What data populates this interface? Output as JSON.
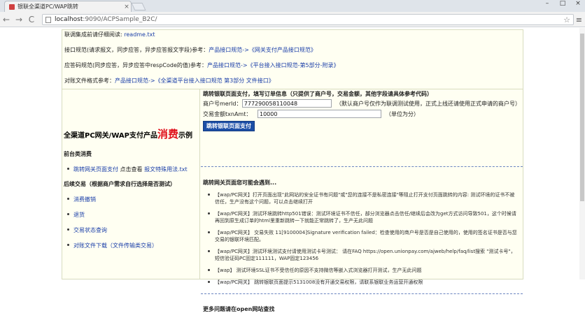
{
  "browser": {
    "tab_title": "银联全渠道PC/WAP跳转",
    "close": "×",
    "win_min": "–",
    "win_max": "□",
    "win_close": "×",
    "back": "←",
    "forward": "→",
    "reload": "C",
    "url_host": "localhost",
    "url_path": ":9090/ACPSample_B2C/",
    "star": "☆",
    "menu": "≡"
  },
  "top": {
    "line1_prefix": "联调集成前请仔细阅读: ",
    "line1_link": "readme.txt",
    "line2_prefix": "接口规范(请求报文，同步应答，异步应答报文字段)参考：",
    "line2_link1": "产品接口规范->",
    "line2_link2": "《网关支付产品接口规范》",
    "line3_prefix": "应答码规范(同步应答，异步应答中respCode的值)参考：",
    "line3_link1": "产品接口规范->",
    "line3_link2": "《平台接入接口规范-第5部分-附录》",
    "line4_prefix": "对账文件格式参考：",
    "line4_link1": "产品接口规范->",
    "line4_link2": "《全渠道平台接入接口规范 第3部分 文件接口》"
  },
  "left": {
    "title_a": "全渠道PC网关/WAP支付产品",
    "title_hot": "消费",
    "title_b": "示例",
    "sec1": "前台类消费",
    "item1_link": "跳转网关页面支付",
    "item1_mid": "  点击查看 ",
    "item1_link2": "报文特殊用法.txt",
    "sec2": "后续交易（根据商户需求自行选择是否测试）",
    "items": [
      "消费撤销",
      "退货",
      "交易状态查询",
      "对账文件下载（文件传输类交易）"
    ]
  },
  "form": {
    "heading": "跳转银联页面支付，填写订单信息（只提供了商户号，交易金额，其他字段请具体参考代码）",
    "mer_label": "商户号merId：",
    "mer_value": "777290058110048",
    "mer_note": "（默认商户号仅作为联调测试使用，正式上线还请使用正式申请的商户号）",
    "amt_label": "交易金额txnAmt：",
    "amt_value": "10000",
    "amt_note": "（单位为分）",
    "submit": "跳转银联页面支付"
  },
  "problems": {
    "title": "跳转网关页面您可能会遇到...",
    "items": [
      "【wap/PC网关】打开页面出现\"此网站的安全证书有问题\"或\"您的连接不是私密连接\"等阻止打开支付页面跳转的内容: 测试环境的证书不被信任，生产没有这个问题，可以点击继续打开",
      "【wap/PC网关】测试环境跳转http501错误：测试环境证书不信任，部分浏览器点击信任/继续后会改为get方式访问导致501，这个时候请再回到原生成订单的html里重新跳转一下就能正常跳转了，生产无此问题",
      "【wap/PC网关】 交易失败 11[9100004]Signature verification failed：检查使用的商户号是否是自己使用的，使用的签名证书是否与您交易的银联环境匹配。",
      "【wap/PC网关】测试环境测试支付请使用测试卡号测试： 请在FAQ https://open.unionpay.com/ajweb/help/faq/list搜索 \"测试卡号\"，短信验证码PC固定111111，WAP固定123456",
      "【wap】 测试环境SSL证书不受信任的原因不支持微信等嵌入式浏览器打开测试，生产无此问题",
      "【wap/PC网关】 跳转银联页面提示5131008没有开通交易权限，请联系银联业务运营开通权限"
    ],
    "more": "更多问题请在open网站查找"
  }
}
